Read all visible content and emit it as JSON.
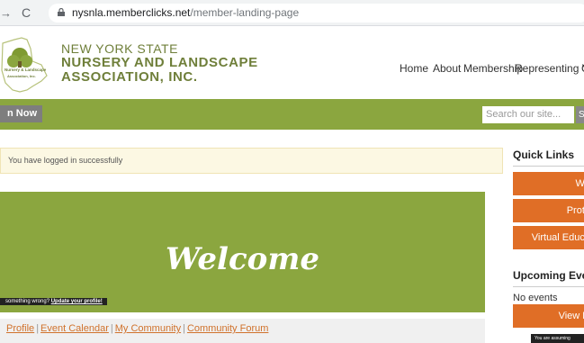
{
  "browser": {
    "back_icon": "arrow-left-icon",
    "reload_icon": "reload-icon",
    "url_host": "nysnla.memberclicks.net",
    "url_path": "/member-landing-page"
  },
  "org": {
    "line1": "NEW YORK STATE",
    "line2": "NURSERY AND LANDSCAPE",
    "line3": "ASSOCIATION, INC."
  },
  "nav": {
    "items": [
      "Home",
      "About",
      "Membership",
      "Representing You"
    ],
    "partial": "C"
  },
  "bar": {
    "join_label": "n Now",
    "search_placeholder": "Search our site...",
    "search_button": "S"
  },
  "alert": {
    "text": "You have logged in successfully"
  },
  "welcome": {
    "title": "Welcome",
    "wrong_text": "something wrong?",
    "wrong_link": "Update your profile!"
  },
  "links": {
    "items": [
      "Profile",
      "Event Calendar",
      "My Community",
      "Community Forum"
    ]
  },
  "sidebar": {
    "quick_links_title": "Quick Links",
    "quick_buttons": [
      "Wh",
      "Prote",
      "Virtual Educa"
    ],
    "upcoming_title": "Upcoming Events",
    "no_events": "No events",
    "view_button": "View F",
    "tooltip": "You are assuming"
  },
  "colors": {
    "brand_green": "#8ba63f",
    "accent_orange": "#e06e26",
    "logo_text": "#6f7f3a"
  }
}
